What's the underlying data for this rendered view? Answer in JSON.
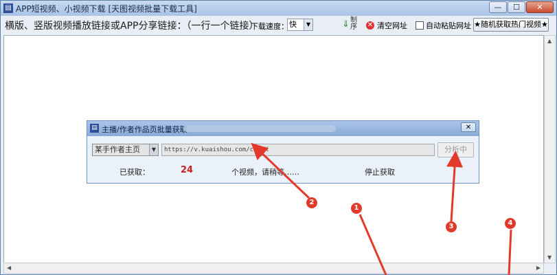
{
  "window": {
    "title": "APP短视频、小视频下载 [天图视频批量下载工具]",
    "icon": "film-icon",
    "controls": {
      "minimize": "—",
      "maximize": "☐",
      "close": "✕"
    }
  },
  "toolbar": {
    "instruction": "横版、竖版视频播放链接或APP分享链接：（一行一个链接）",
    "speed_label": "下载速度：",
    "speed_value": "快",
    "download_vertical_text": "制序",
    "clear_label": "清空网址",
    "auto_paste_label": "自动粘贴网址",
    "auto_paste_checked": false,
    "hot_video_label": "★随机获取热门视频★"
  },
  "dialog": {
    "title": "主播/作者作品页批量获取",
    "close": "✕",
    "type_value": "某手作者主页",
    "url_value": "https://v.kuaishou.com/caRtK",
    "analyze_label": "分析中",
    "fetched_label": "已获取：",
    "fetched_count": "24",
    "progress_text": "个视频，请稍等……",
    "stop_label": "停止获取"
  },
  "annotations": [
    {
      "label": "1",
      "color": "#e23a2a"
    },
    {
      "label": "2",
      "color": "#e23a2a"
    },
    {
      "label": "3",
      "color": "#e23a2a"
    },
    {
      "label": "4",
      "color": "#e23a2a"
    }
  ]
}
